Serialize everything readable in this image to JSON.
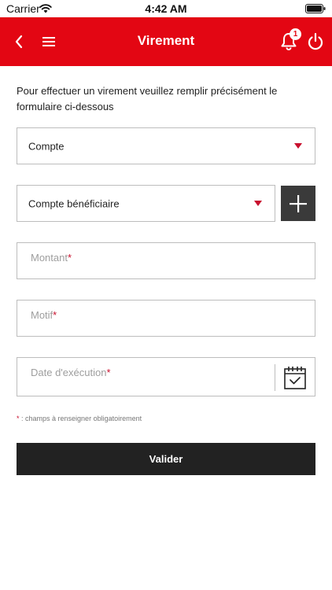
{
  "status_bar": {
    "carrier": "Carrier",
    "time": "4:42 AM"
  },
  "header": {
    "title": "Virement",
    "notifications_count": "1"
  },
  "intro": "Pour effectuer un virement veuillez remplir précisément le formulaire ci-dessous",
  "form": {
    "account_select": {
      "label": "Compte"
    },
    "beneficiary_select": {
      "label": "Compte bénéficiaire"
    },
    "amount": {
      "placeholder": "Montant",
      "required_mark": "*"
    },
    "reason": {
      "placeholder": "Motif",
      "required_mark": "*"
    },
    "execution_date": {
      "placeholder": "Date d'exécution",
      "required_mark": "*"
    },
    "required_note": {
      "mark": "*",
      "text": " : champs à renseigner obligatoirement"
    },
    "submit_label": "Valider"
  },
  "colors": {
    "brand": "#e30613",
    "accent": "#c8102e",
    "dark": "#222222"
  },
  "icons": [
    "wifi-icon",
    "battery-icon",
    "back-icon",
    "menu-icon",
    "bell-icon",
    "power-icon",
    "plus-icon",
    "calendar-icon",
    "caret-down-icon"
  ]
}
